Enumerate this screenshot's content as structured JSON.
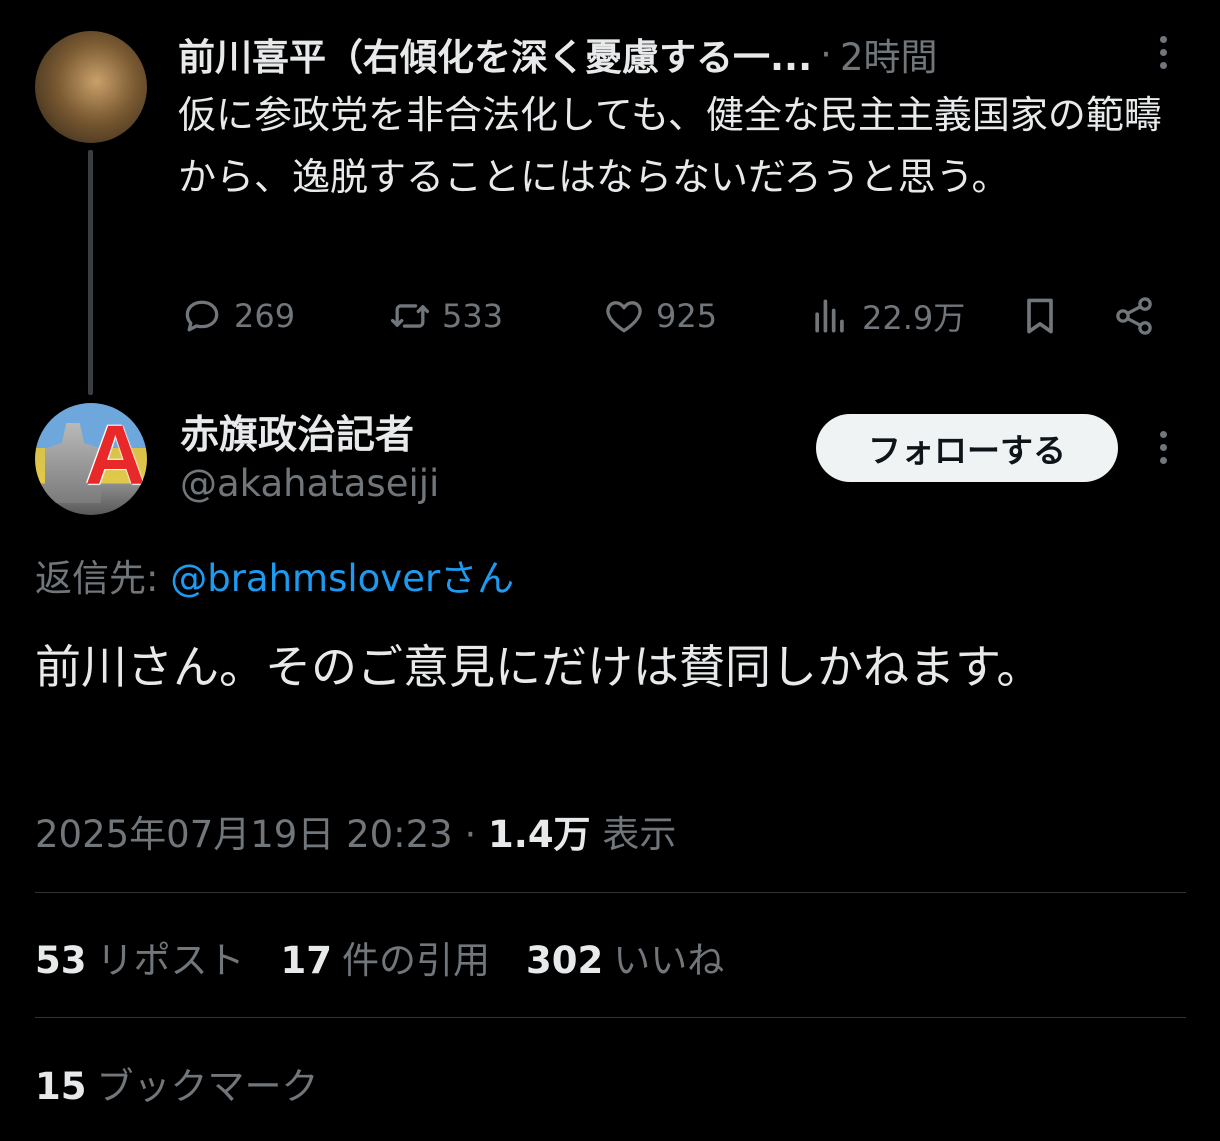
{
  "parent_tweet": {
    "author_name": "前川喜平（右傾化を深く憂慮する一...",
    "separator": "·",
    "time": "2時間",
    "text": "仮に参政党を非合法化しても、健全な民主主義国家の範疇から、逸脱することにはならないだろうと思う。",
    "replies": "269",
    "reposts": "533",
    "likes": "925",
    "views": "22.9万"
  },
  "main_tweet": {
    "author_name": "赤旗政治記者",
    "handle": "@akahataseiji",
    "follow_label": "フォローする",
    "reply_to_label": "返信先: ",
    "reply_to_mention": "@brahmsloverさん",
    "text": "前川さん。そのご意見にだけは賛同しかねます。",
    "datetime": "2025年07月19日 20:23",
    "separator": " · ",
    "views_count": "1.4万",
    "views_label": " 表示",
    "avatar_letter": "A",
    "stats": {
      "reposts_count": "53",
      "reposts_label": "リポスト",
      "quotes_count": "17",
      "quotes_label": "件の引用",
      "likes_count": "302",
      "likes_label": "いいね",
      "bookmarks_count": "15",
      "bookmarks_label": "ブックマーク"
    }
  },
  "colors": {
    "background": "#000000",
    "text": "#e7e9ea",
    "secondary": "#71767b",
    "link": "#1d9bf0",
    "divider": "#2f3336"
  }
}
